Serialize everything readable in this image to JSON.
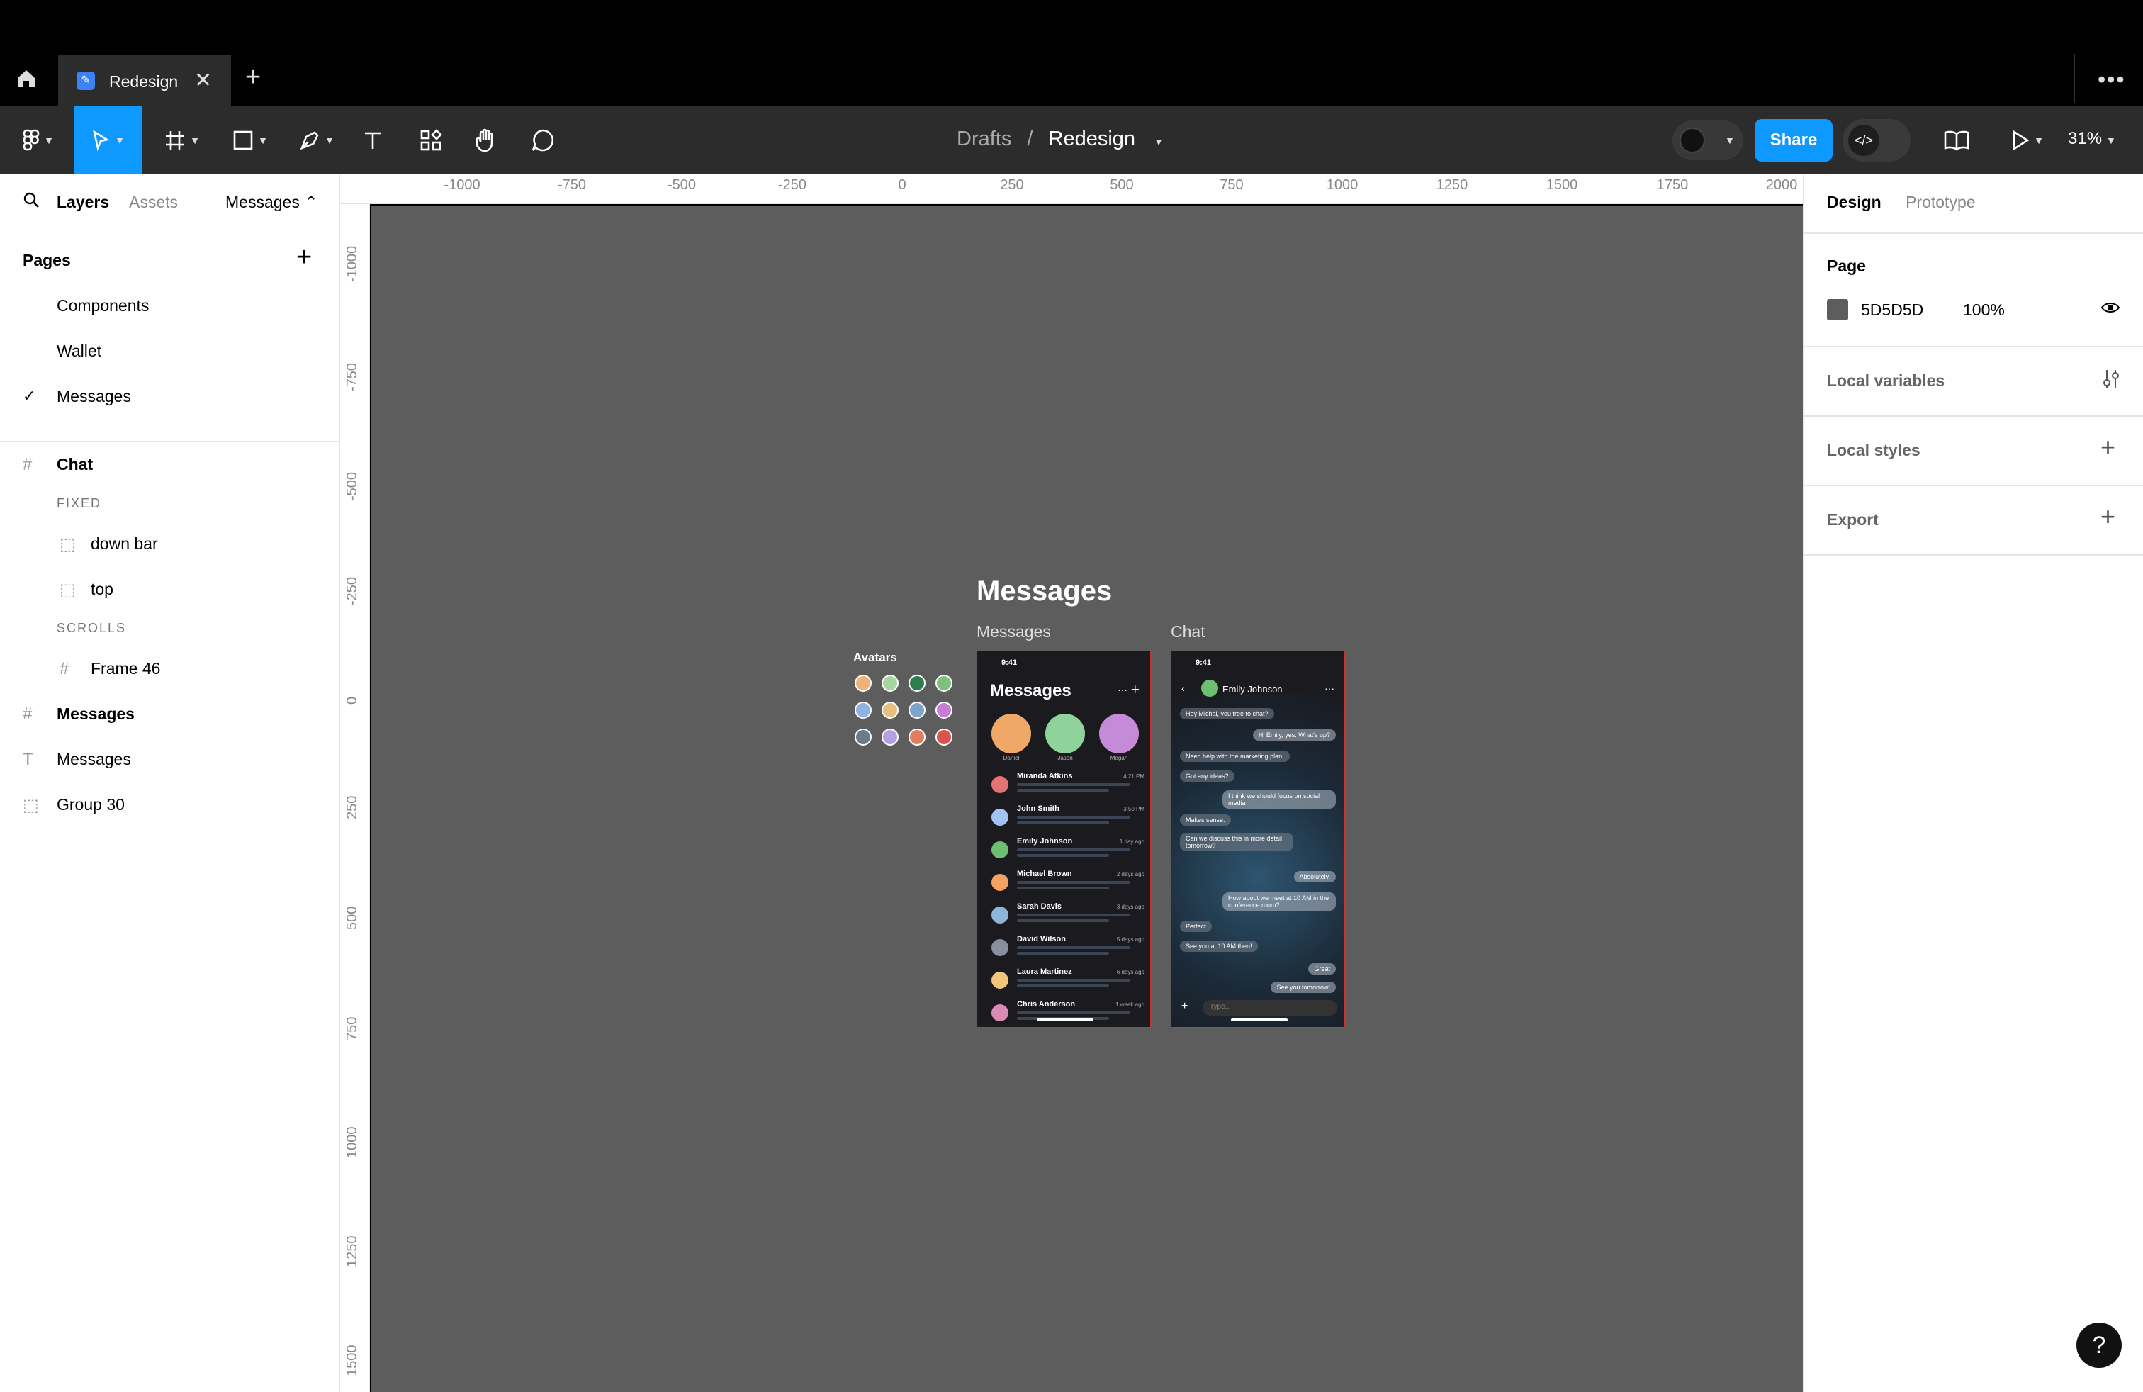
{
  "tab": {
    "title": "Redesign",
    "close": "✕",
    "new": "+"
  },
  "menu_dots": "•••",
  "toolbar": {
    "breadcrumb_parent": "Drafts",
    "breadcrumb_sep": "/",
    "breadcrumb_file": "Redesign",
    "share": "Share",
    "zoom": "31%"
  },
  "left_panel": {
    "tabs": {
      "layers": "Layers",
      "assets": "Assets",
      "page_selector": "Messages ⌃"
    },
    "pages_title": "Pages",
    "pages": [
      "Components",
      "Wallet",
      "Messages"
    ],
    "selected_check": "✓",
    "layers": [
      {
        "name": "Chat",
        "icon": "#"
      },
      {
        "section": "FIXED"
      },
      {
        "name": "down bar",
        "icon": "⬚"
      },
      {
        "name": "top",
        "icon": "⬚"
      },
      {
        "section": "SCROLLS"
      },
      {
        "name": "Frame 46",
        "icon": "#"
      },
      {
        "name": "Messages",
        "icon": "#"
      },
      {
        "name": "Messages",
        "icon": "T"
      },
      {
        "name": "Group 30",
        "icon": "⬚"
      }
    ]
  },
  "right_panel": {
    "tabs": {
      "design": "Design",
      "prototype": "Prototype"
    },
    "page_label": "Page",
    "page_color": "5D5D5D",
    "page_opacity": "100%",
    "local_variables": "Local variables",
    "local_styles": "Local styles",
    "export": "Export",
    "add": "+"
  },
  "ruler": {
    "x_ticks": [
      "-1000",
      "-750",
      "-500",
      "-250",
      "0",
      "250",
      "500",
      "750",
      "1000",
      "1250",
      "1500",
      "1750",
      "2000"
    ],
    "y_ticks": [
      "-1000",
      "-750",
      "-500",
      "-250",
      "0",
      "250",
      "500",
      "750",
      "1000",
      "1250",
      "1500"
    ]
  },
  "canvas": {
    "title": "Messages",
    "frame_messages_label": "Messages",
    "frame_chat_label": "Chat",
    "avatars_label": "Avatars",
    "avatar_colors": [
      "#f0b27a",
      "#a7d7a0",
      "#2f7d4f",
      "#7fbf7f",
      "#8fb3e0",
      "#e8c07d",
      "#7fa3c9",
      "#c77dd6",
      "#6c7a89",
      "#b4a0e0",
      "#e07f60",
      "#d9534f"
    ],
    "messages_screen": {
      "time": "9:41",
      "title": "Messages",
      "stories": [
        {
          "name": "Daniel",
          "color": "#f0a868"
        },
        {
          "name": "Jason",
          "color": "#8fd39a"
        },
        {
          "name": "Megan",
          "color": "#c58bd8"
        }
      ],
      "threads": [
        {
          "name": "Miranda Atkins",
          "time": "4:21 PM",
          "color": "#e57373"
        },
        {
          "name": "John Smith",
          "time": "3:50 PM",
          "color": "#a3c4f3"
        },
        {
          "name": "Emily Johnson",
          "time": "1 day ago",
          "color": "#6fbf73"
        },
        {
          "name": "Michael Brown",
          "time": "2 days ago",
          "color": "#f4a261"
        },
        {
          "name": "Sarah Davis",
          "time": "3 days ago",
          "color": "#90b4d6"
        },
        {
          "name": "David Wilson",
          "time": "5 days ago",
          "color": "#8a8fa0"
        },
        {
          "name": "Laura Martinez",
          "time": "6 days ago",
          "color": "#f2c57c"
        },
        {
          "name": "Chris Anderson",
          "time": "1 week ago",
          "color": "#d98ab5"
        }
      ]
    },
    "chat_screen": {
      "time": "9:41",
      "contact": "Emily Johnson",
      "messages": [
        {
          "text": "Hey Michal, you free to chat?",
          "me": false
        },
        {
          "text": "Hi Emily, yes. What's up?",
          "me": true
        },
        {
          "text": "Need help with the marketing plan.",
          "me": false
        },
        {
          "text": "Got any ideas?",
          "me": false
        },
        {
          "text": "I think we should focus on social media",
          "me": true
        },
        {
          "text": "Makes sense.",
          "me": false
        },
        {
          "text": "Can we discuss this in more detail tomorrow?",
          "me": false
        },
        {
          "text": "Absolutely.",
          "me": true
        },
        {
          "text": "How about we meet at 10 AM in the conference room?",
          "me": true
        },
        {
          "text": "Perfect",
          "me": false
        },
        {
          "text": "See you at 10 AM then!",
          "me": false
        },
        {
          "text": "Great",
          "me": true
        },
        {
          "text": "See you tomorrow!",
          "me": true
        }
      ],
      "input_placeholder": "Type..."
    }
  },
  "help": "?"
}
